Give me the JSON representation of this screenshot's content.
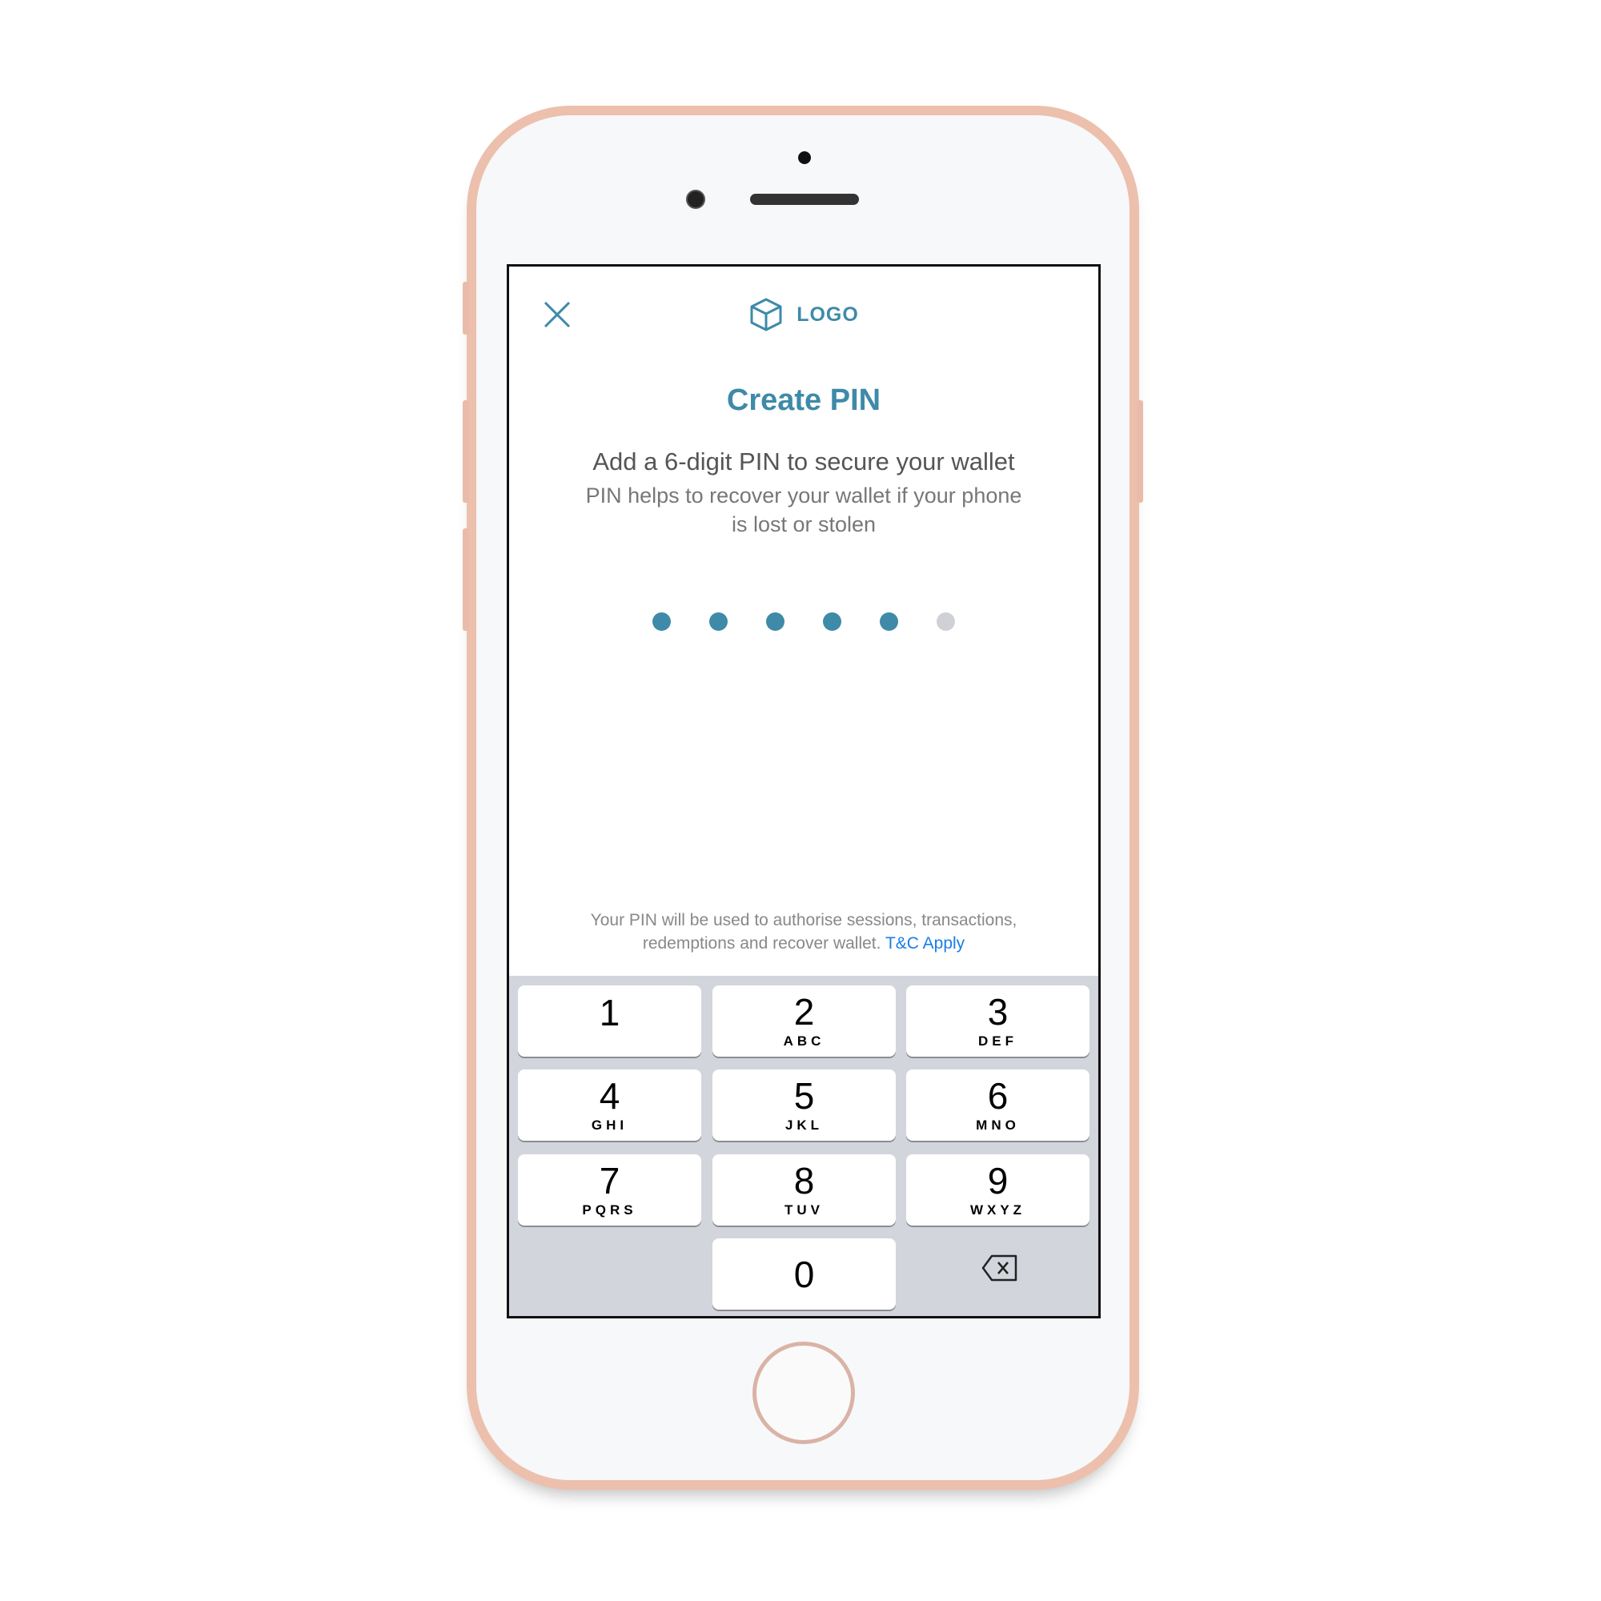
{
  "header": {
    "logo_text": "LOGO",
    "close_icon": "close-icon",
    "logo_icon": "cube-icon"
  },
  "title": "Create PIN",
  "heading": "Add a 6-digit PIN to secure your wallet",
  "description": "PIN helps to recover your wallet if your phone is lost or stolen",
  "pin": {
    "length": 6,
    "filled": 5,
    "accent": "#3e8aa8",
    "empty_color": "#cfd1d6"
  },
  "footer": {
    "text": "Your PIN will be used to authorise sessions, transactions, redemptions and recover wallet.",
    "link": "T&C Apply",
    "link_color": "#1a7ee6"
  },
  "keypad": {
    "keys": [
      {
        "digit": "1",
        "letters": ""
      },
      {
        "digit": "2",
        "letters": "ABC"
      },
      {
        "digit": "3",
        "letters": "DEF"
      },
      {
        "digit": "4",
        "letters": "GHI"
      },
      {
        "digit": "5",
        "letters": "JKL"
      },
      {
        "digit": "6",
        "letters": "MNO"
      },
      {
        "digit": "7",
        "letters": "PQRS"
      },
      {
        "digit": "8",
        "letters": "TUV"
      },
      {
        "digit": "9",
        "letters": "WXYZ"
      },
      {
        "digit": "0",
        "letters": ""
      }
    ],
    "delete_icon": "backspace-icon"
  }
}
